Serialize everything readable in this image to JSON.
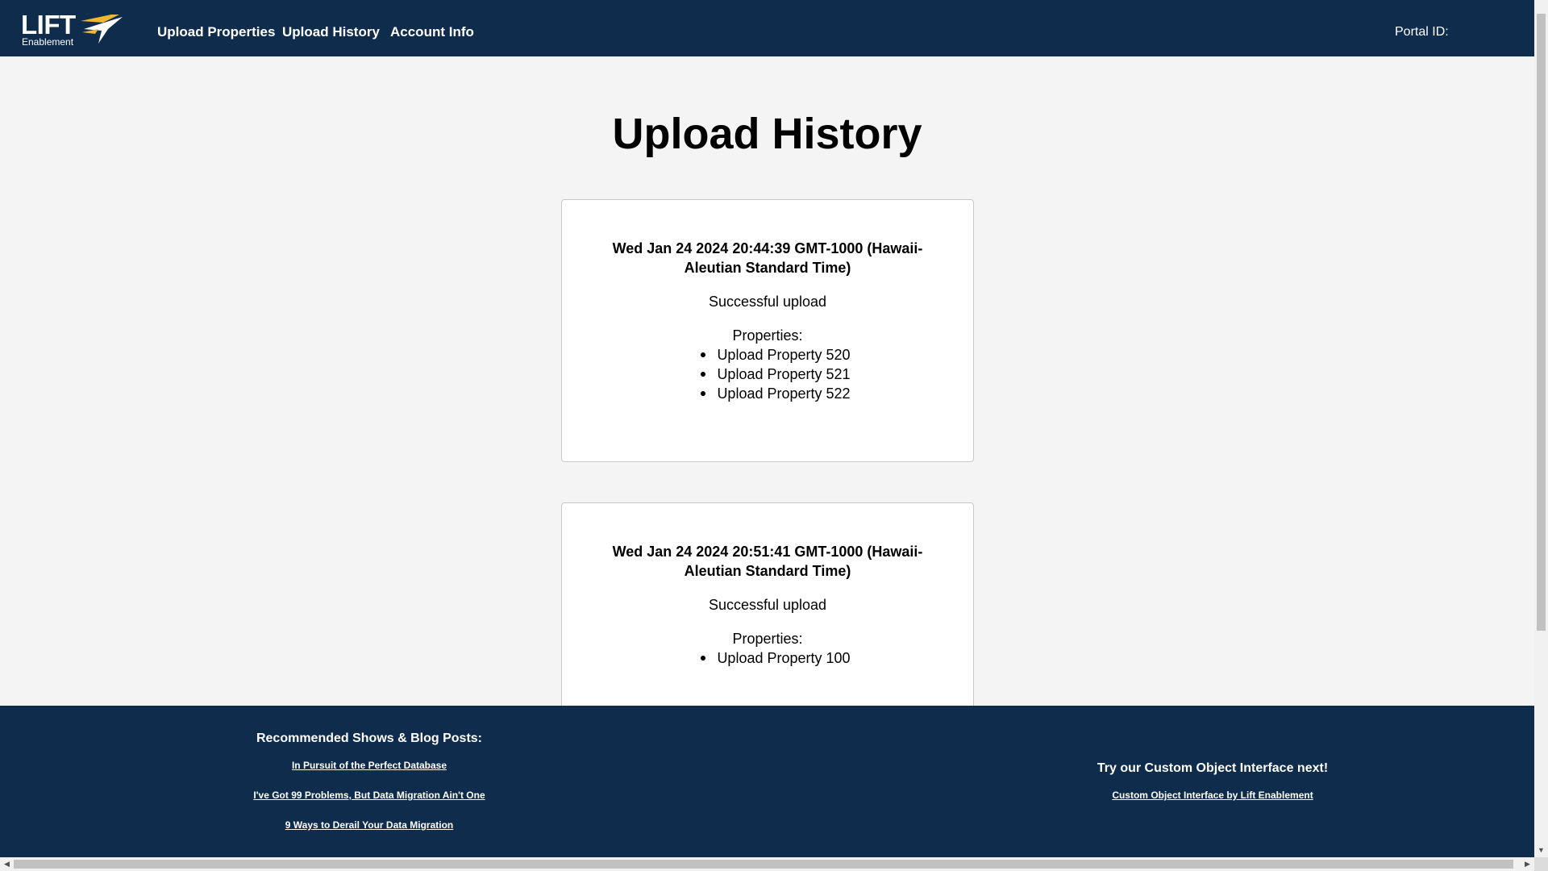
{
  "header": {
    "logo_main": "LIFT",
    "logo_sub": "Enablement",
    "nav": {
      "upload_properties": "Upload Properties",
      "upload_history": "Upload History",
      "account_info": "Account Info"
    },
    "portal_id_label": "Portal ID:"
  },
  "page": {
    "title": "Upload History"
  },
  "uploads": [
    {
      "date": "Wed Jan 24 2024 20:44:39 GMT-1000 (Hawaii-Aleutian Standard Time)",
      "status": "Successful upload",
      "properties_label": "Properties:",
      "properties": [
        "Upload Property 520",
        "Upload Property 521",
        "Upload Property 522"
      ]
    },
    {
      "date": "Wed Jan 24 2024 20:51:41 GMT-1000 (Hawaii-Aleutian Standard Time)",
      "status": "Successful upload",
      "properties_label": "Properties:",
      "properties": [
        "Upload Property 100"
      ]
    }
  ],
  "footer": {
    "left_title": "Recommended Shows & Blog Posts:",
    "links": [
      "In Pursuit of the Perfect Database",
      "I've Got 99 Problems, But Data Migration Ain't One",
      "9 Ways to Derail Your Data Migration"
    ],
    "right_title": "Try our Custom Object Interface next!",
    "right_link": "Custom Object Interface by Lift Enablement"
  },
  "colors": {
    "navy": "#0f2c4d",
    "logo_accent": "#f2b632",
    "page_bg": "#f4f4f4"
  },
  "icons": {
    "logo_mark": "lift-wing-icon",
    "scroll_down": "scroll-down-arrow-icon",
    "scroll_left": "scroll-left-arrow-icon",
    "scroll_right": "scroll-right-arrow-icon"
  }
}
